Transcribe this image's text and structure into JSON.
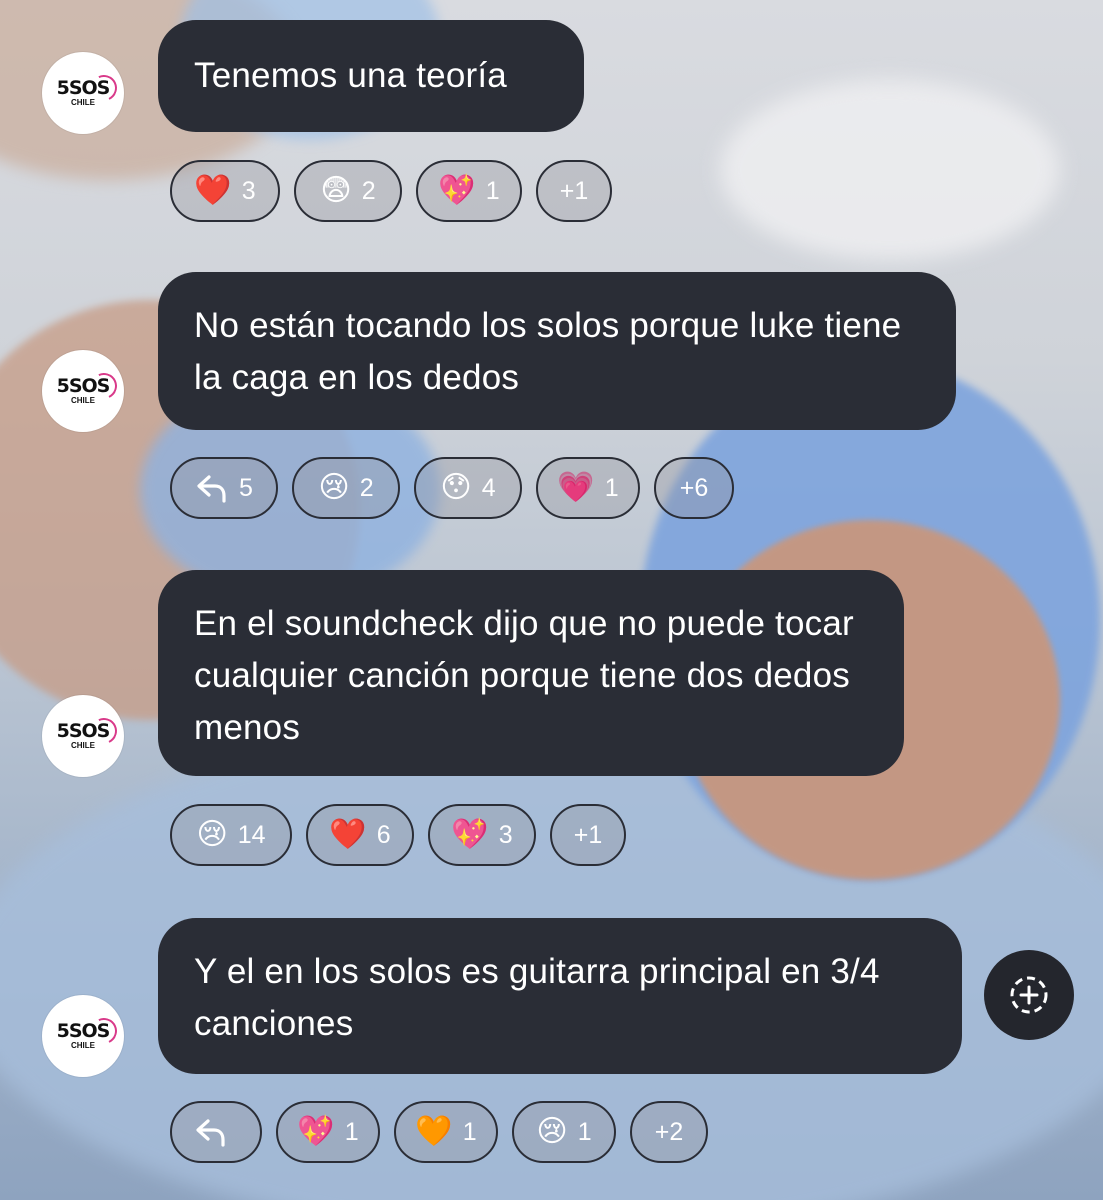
{
  "messages": [
    {
      "avatar": {
        "logo": "5SOS",
        "sub": "CHILE"
      },
      "text": "Tenemos una teoría",
      "reactions": [
        {
          "type": "emoji",
          "emoji": "❤️",
          "count": "3"
        },
        {
          "type": "emoji",
          "emoji": "😨",
          "count": "2"
        },
        {
          "type": "emoji",
          "emoji": "💖",
          "count": "1"
        },
        {
          "type": "more",
          "label": "+1"
        }
      ]
    },
    {
      "avatar": {
        "logo": "5SOS",
        "sub": "CHILE"
      },
      "text": "No están tocando los solos porque luke tiene la caga en los dedos",
      "reactions": [
        {
          "type": "reply",
          "icon": "reply-arrow-icon",
          "count": "5"
        },
        {
          "type": "emoji",
          "emoji": "😢",
          "count": "2"
        },
        {
          "type": "emoji",
          "emoji": "😯",
          "count": "4"
        },
        {
          "type": "emoji",
          "emoji": "💗",
          "count": "1"
        },
        {
          "type": "more",
          "label": "+6"
        }
      ]
    },
    {
      "avatar": {
        "logo": "5SOS",
        "sub": "CHILE"
      },
      "text": "En el soundcheck dijo que no puede tocar cualquier canción porque tiene dos dedos menos",
      "reactions": [
        {
          "type": "emoji",
          "emoji": "😢",
          "count": "14"
        },
        {
          "type": "emoji",
          "emoji": "❤️",
          "count": "6"
        },
        {
          "type": "emoji",
          "emoji": "💖",
          "count": "3"
        },
        {
          "type": "more",
          "label": "+1"
        }
      ]
    },
    {
      "avatar": {
        "logo": "5SOS",
        "sub": "CHILE"
      },
      "text": "Y el en los solos es guitarra principal en 3/4 canciones",
      "reactions": [
        {
          "type": "reply",
          "icon": "reply-arrow-icon",
          "count": ""
        },
        {
          "type": "emoji",
          "emoji": "💖",
          "count": "1"
        },
        {
          "type": "emoji",
          "emoji": "🧡",
          "count": "1"
        },
        {
          "type": "emoji",
          "emoji": "😢",
          "count": "1"
        },
        {
          "type": "more",
          "label": "+2"
        }
      ]
    }
  ],
  "add_reaction_icon": "add-reaction-icon"
}
